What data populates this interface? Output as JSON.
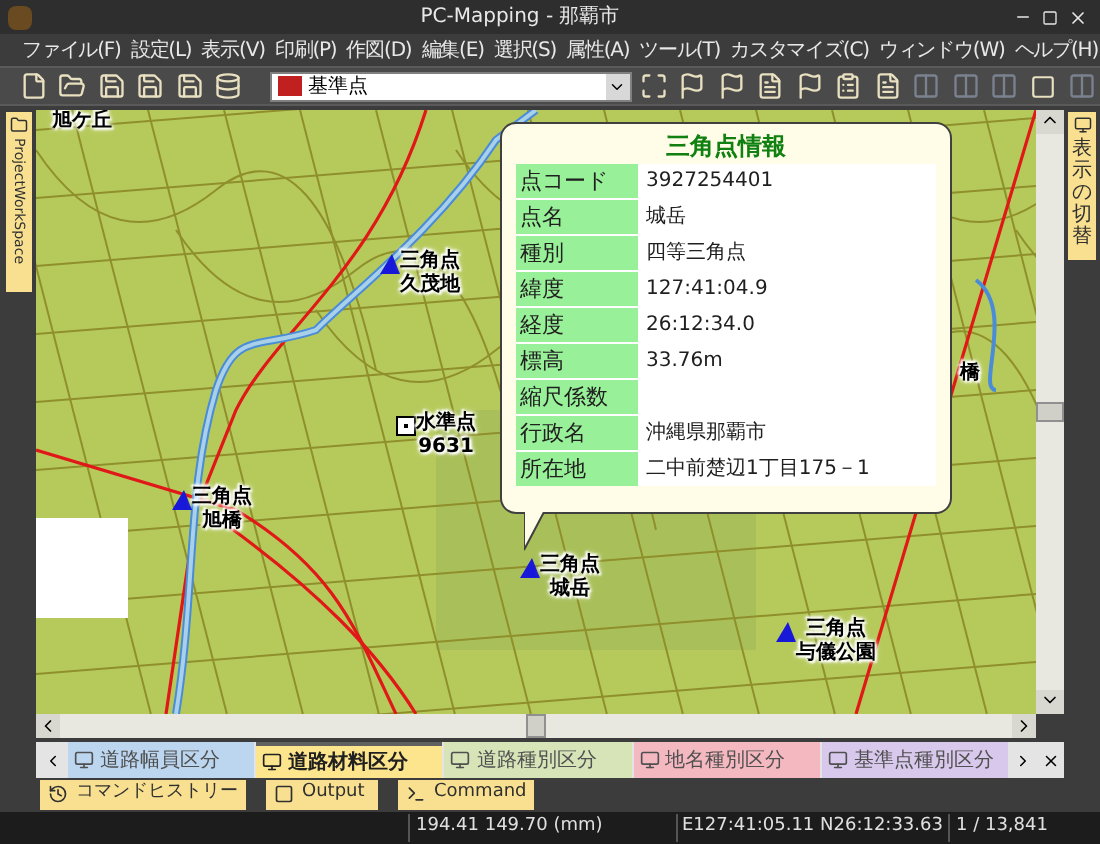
{
  "window": {
    "title": "PC-Mapping - 那覇市"
  },
  "menu": [
    "ファイル(F)",
    "設定(L)",
    "表示(V)",
    "印刷(P)",
    "作図(D)",
    "編集(E)",
    "選択(S)",
    "属性(A)",
    "ツール(T)",
    "カスタマイズ(C)",
    "ウィンドウ(W)",
    "ヘルプ(H)"
  ],
  "layer_select": {
    "value": "基準点"
  },
  "left_panel": {
    "label": "ProjectWorkSpace"
  },
  "right_panel": {
    "label": "表示の切替"
  },
  "map": {
    "markers": [
      {
        "kind": "label",
        "name": "旭ケ丘"
      },
      {
        "kind": "triangle",
        "type": "三角点",
        "name": "久茂地"
      },
      {
        "kind": "benchmark",
        "type": "水準点",
        "name": "9631"
      },
      {
        "kind": "triangle",
        "type": "三角点",
        "name": "旭橋"
      },
      {
        "kind": "triangle",
        "type": "三角点",
        "name": "城岳"
      },
      {
        "kind": "triangle",
        "type": "三角点",
        "name": "与儀公園"
      },
      {
        "kind": "label",
        "name": "橋"
      }
    ]
  },
  "popup": {
    "title": "三角点情報",
    "rows": [
      {
        "label": "点コード",
        "value": "3927254401"
      },
      {
        "label": "点名",
        "value": "城岳"
      },
      {
        "label": "種別",
        "value": "四等三角点"
      },
      {
        "label": "緯度",
        "value": "127:41:04.9"
      },
      {
        "label": "経度",
        "value": "26:12:34.0"
      },
      {
        "label": "標高",
        "value": "33.76m"
      },
      {
        "label": "縮尺係数",
        "value": ""
      },
      {
        "label": "行政名",
        "value": "沖縄県那覇市"
      },
      {
        "label": "所在地",
        "value": "二中前楚辺1丁目175－1"
      }
    ]
  },
  "layer_tabs": [
    {
      "label": "道路幅員区分",
      "color": "#bcd6f0",
      "selected": false
    },
    {
      "label": "道路材料区分",
      "color": "#fce58c",
      "selected": true
    },
    {
      "label": "道路種別区分",
      "color": "#d6e4b8",
      "selected": false
    },
    {
      "label": "地名種別区分",
      "color": "#f4b8c0",
      "selected": false
    },
    {
      "label": "基準点種別区分",
      "color": "#d8c8ec",
      "selected": false
    }
  ],
  "panel_buttons": [
    "コマンドヒストリー",
    "Output",
    "Command"
  ],
  "status_bar": {
    "coords_mm": "194.41 149.70 (mm)",
    "latlon": "E127:41:05.11 N26:12:33.63",
    "count": "1 / 13,841"
  }
}
